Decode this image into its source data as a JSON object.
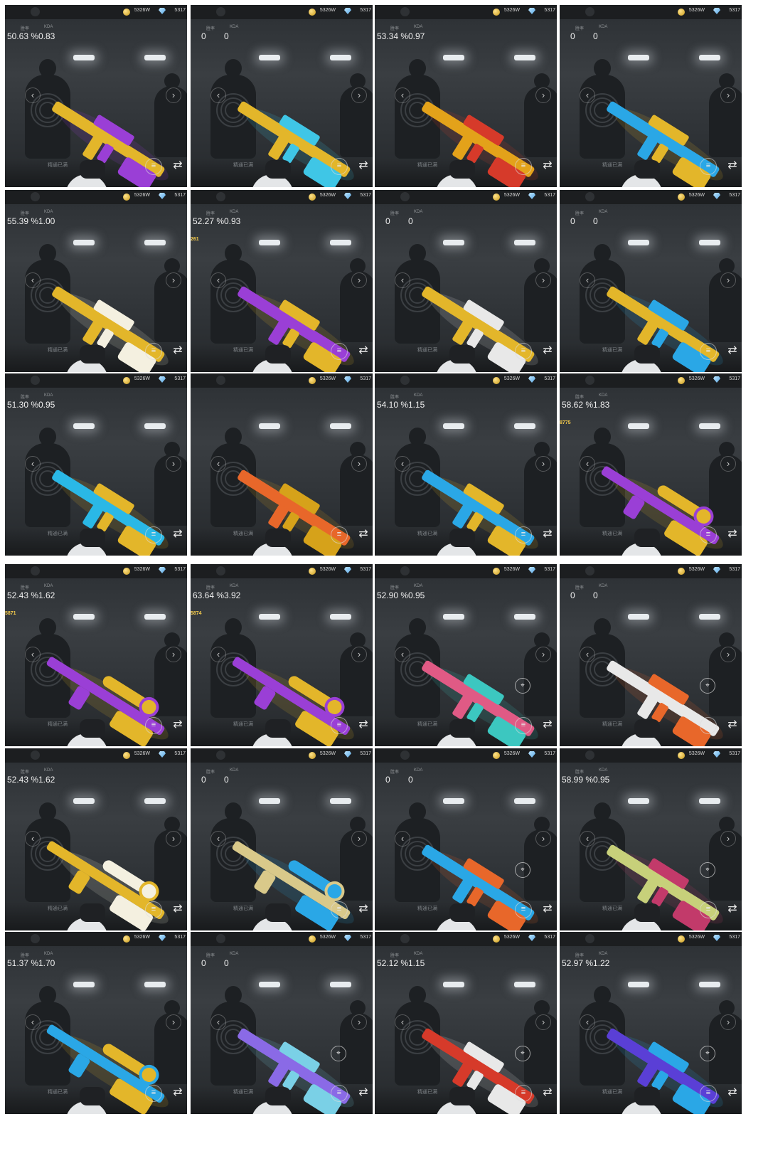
{
  "labels": {
    "win": "胜率",
    "kda": "KDA"
  },
  "currency": {
    "coins": "5326W",
    "gems": "5317"
  },
  "common": {
    "prev": "‹",
    "next": "›",
    "plaque": "精通已满"
  },
  "colors": {
    "background": "#ffffff",
    "tile": "#33373b",
    "gold": "#e3b62a",
    "purple": "#9a3fd6",
    "blue": "#2aa7e6",
    "red": "#d63a2a",
    "orange": "#e8672a",
    "pink": "#e05a85",
    "teal": "#3cc7c0"
  },
  "tiles": [
    {
      "winrate": "50.63 %",
      "kda": "0.83",
      "gun": "rifle",
      "c1": "#e3b62a",
      "c2": "#9a3fd6"
    },
    {
      "winrate": "0",
      "kda": "0",
      "gun": "rifle",
      "c1": "#e3b62a",
      "c2": "#3fc6e6"
    },
    {
      "winrate": "53.34 %",
      "kda": "0.97",
      "gun": "rifle",
      "c1": "#e3a21a",
      "c2": "#d63a2a"
    },
    {
      "winrate": "0",
      "kda": "0",
      "gun": "rifle",
      "c1": "#2aa7e6",
      "c2": "#e3b62a"
    },
    {
      "winrate": "55.39 %",
      "kda": "1.00",
      "gun": "rifle",
      "c1": "#e3b62a",
      "c2": "#f4f0e0"
    },
    {
      "winrate": "52.27 %",
      "kda": "0.93",
      "gun": "rifle",
      "c1": "#9a3fd6",
      "c2": "#e3b62a",
      "tag": "261"
    },
    {
      "winrate": "0",
      "kda": "0",
      "gun": "rifle",
      "c1": "#e3b62a",
      "c2": "#e8e8e8"
    },
    {
      "winrate": "0",
      "kda": "0",
      "gun": "rifle",
      "c1": "#e3b62a",
      "c2": "#2aa7e6"
    },
    {
      "winrate": "51.30 %",
      "kda": "0.95",
      "gun": "rifle",
      "c1": "#2ab8e6",
      "c2": "#e3b62a"
    },
    {
      "winrate": "",
      "kda": "",
      "gun": "rifle",
      "c1": "#e8672a",
      "c2": "#d6a21a"
    },
    {
      "winrate": "54.10 %",
      "kda": "1.15",
      "gun": "rifle",
      "c1": "#2aa7e6",
      "c2": "#e3b62a"
    },
    {
      "winrate": "58.62 %",
      "kda": "1.83",
      "gun": "sniper",
      "c1": "#9a3fd6",
      "c2": "#e3b62a",
      "tag": "8775"
    },
    {
      "winrate": "52.43 %",
      "kda": "1.62",
      "gun": "sniper",
      "c1": "#9a3fd6",
      "c2": "#e3b62a",
      "tag": "5871"
    },
    {
      "winrate": "63.64 %",
      "kda": "3.92",
      "gun": "sniper",
      "c1": "#9a3fd6",
      "c2": "#e3b62a",
      "tag": "5874"
    },
    {
      "winrate": "52.90 %",
      "kda": "0.95",
      "gun": "rifle",
      "c1": "#e05a85",
      "c2": "#3cc7c0",
      "aim": true
    },
    {
      "winrate": "0",
      "kda": "0",
      "gun": "rifle",
      "c1": "#e8e8e8",
      "c2": "#e8672a",
      "aim": true
    },
    {
      "winrate": "52.43 %",
      "kda": "1.62",
      "gun": "sniper",
      "c1": "#e3b62a",
      "c2": "#f4f0e0"
    },
    {
      "winrate": "0",
      "kda": "0",
      "gun": "sniper",
      "c1": "#d9c98a",
      "c2": "#2aa7e6"
    },
    {
      "winrate": "0",
      "kda": "0",
      "gun": "rifle",
      "c1": "#2aa7e6",
      "c2": "#e8672a",
      "aim": true
    },
    {
      "winrate": "58.99 %",
      "kda": "0.95",
      "gun": "rifle",
      "c1": "#c7d07a",
      "c2": "#c23a6a",
      "aim": true
    },
    {
      "winrate": "51.37 %",
      "kda": "1.70",
      "gun": "sniper",
      "c1": "#2aa7e6",
      "c2": "#e3b62a"
    },
    {
      "winrate": "0",
      "kda": "0",
      "gun": "rifle",
      "c1": "#8a6ae6",
      "c2": "#7ad0e6",
      "aim": true
    },
    {
      "winrate": "52.12 %",
      "kda": "1.15",
      "gun": "rifle",
      "c1": "#d63a2a",
      "c2": "#e8e8e8",
      "aim": true
    },
    {
      "winrate": "52.97 %",
      "kda": "1.22",
      "gun": "rifle",
      "c1": "#5a3fd6",
      "c2": "#2aa7e6",
      "aim": true
    }
  ]
}
